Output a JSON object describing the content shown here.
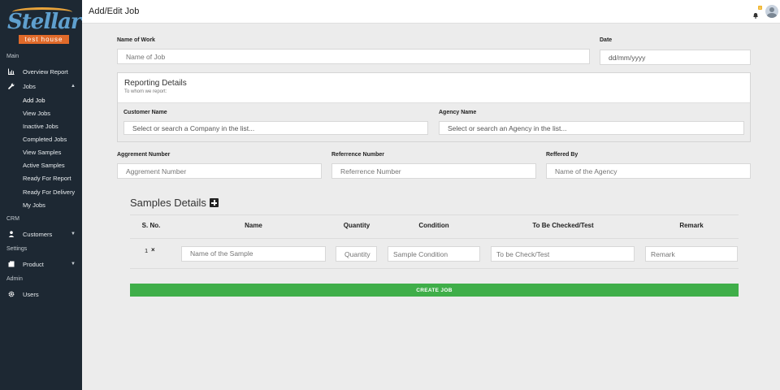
{
  "brand": {
    "name": "Stellar",
    "sub": "test house"
  },
  "header": {
    "title": "Add/Edit Job",
    "badge": "0"
  },
  "sidebar": {
    "sections": {
      "main": "Main",
      "crm": "CRM",
      "settings": "Settings",
      "admin": "Admin"
    },
    "overview": "Overview Report",
    "jobs": "Jobs",
    "job_items": [
      "Add Job",
      "View Jobs",
      "Inactive Jobs",
      "Completed Jobs",
      "View Samples",
      "Active Samples",
      "Ready For Report",
      "Ready For Delivery",
      "My Jobs"
    ],
    "customers": "Customers",
    "product": "Product",
    "users": "Users"
  },
  "form": {
    "name_of_work": {
      "label": "Name of Work",
      "placeholder": "Name of Job"
    },
    "date": {
      "label": "Date",
      "placeholder": "dd/mm/yyyy"
    },
    "reporting": {
      "title": "Reporting Details",
      "subtitle": "To whom we report:",
      "customer": {
        "label": "Customer Name",
        "placeholder": "Select or search a Company in the list..."
      },
      "agency": {
        "label": "Agency Name",
        "placeholder": "Select or search an Agency in the list..."
      }
    },
    "agreement": {
      "label": "Aggrement Number",
      "placeholder": "Aggrement Number"
    },
    "reference": {
      "label": "Referrence Number",
      "placeholder": "Referrence Number"
    },
    "referred_by": {
      "label": "Reffered By",
      "placeholder": "Name of the Agency"
    }
  },
  "samples": {
    "title": "Samples Details",
    "columns": [
      "S. No.",
      "Name",
      "Quantity",
      "Condition",
      "To Be Checked/Test",
      "Remark"
    ],
    "row": {
      "sno": "1",
      "delete": "×",
      "name_placeholder": "Name of the Sample",
      "quantity_placeholder": "Quantity",
      "condition_placeholder": "Sample Condition",
      "check_placeholder": "To be Check/Test",
      "remark_placeholder": "Remark"
    }
  },
  "actions": {
    "create": "CREATE JOB"
  },
  "colors": {
    "sidebar": "#1d2833",
    "primary_button": "#3fae49",
    "badge": "#f0b429"
  }
}
